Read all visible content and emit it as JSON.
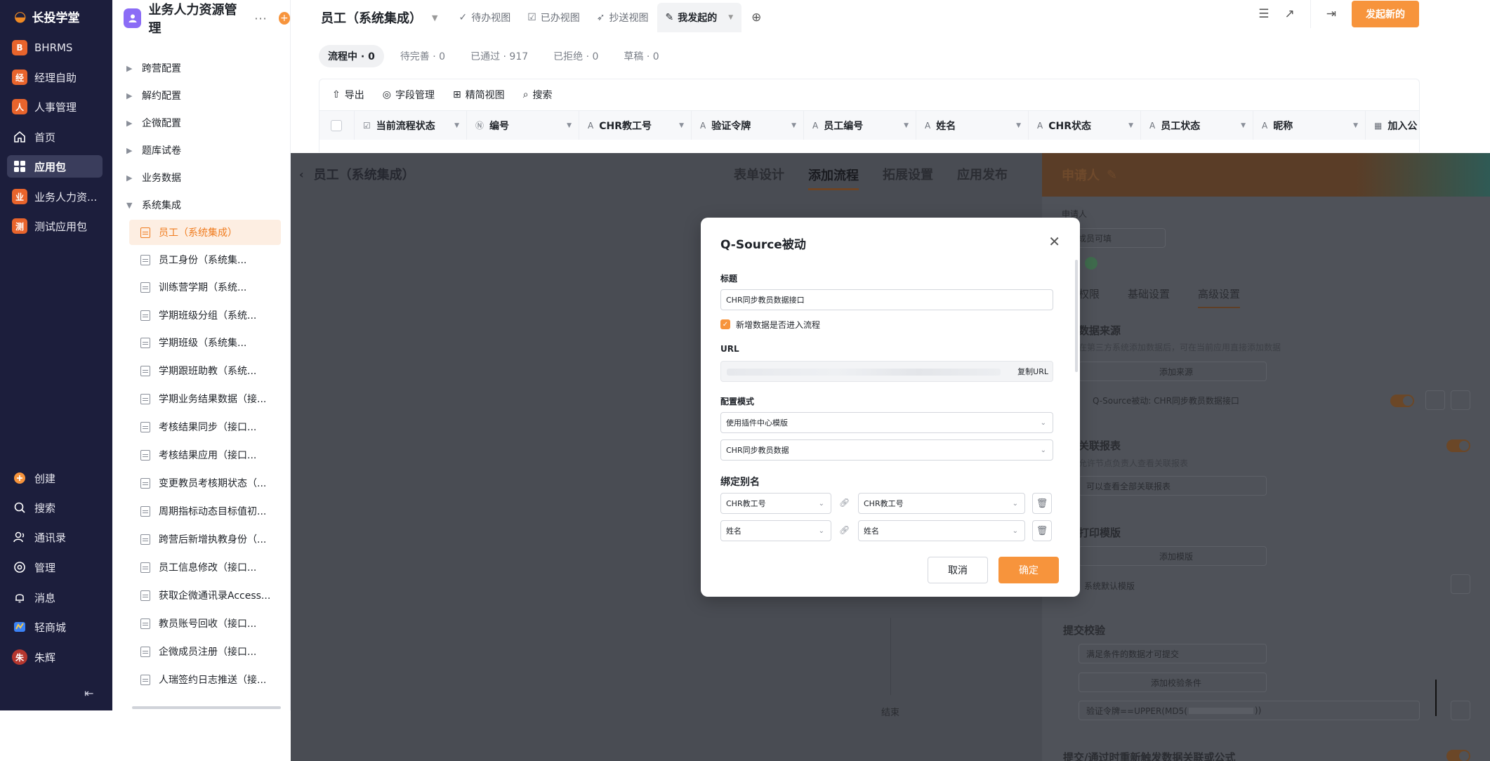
{
  "brand": {
    "name": "长投学堂"
  },
  "nav": {
    "items": [
      {
        "label": "BHRMS",
        "badge": "B",
        "color": "#e8642c"
      },
      {
        "label": "经理自助",
        "badge": "经",
        "color": "#e8642c"
      },
      {
        "label": "人事管理",
        "badge": "人",
        "color": "#e8642c"
      },
      {
        "label": "首页",
        "icon": "home-icon"
      },
      {
        "label": "应用包",
        "icon": "grid-icon",
        "active": true
      },
      {
        "label": "业务人力资...",
        "badge": "业",
        "color": "#e8642c"
      },
      {
        "label": "测试应用包",
        "badge": "测",
        "color": "#e8642c"
      }
    ],
    "bottom": [
      {
        "label": "创建",
        "icon": "plus-circle-icon"
      },
      {
        "label": "搜索",
        "icon": "search-icon"
      },
      {
        "label": "通讯录",
        "icon": "contacts-icon"
      },
      {
        "label": "管理",
        "icon": "settings-icon"
      },
      {
        "label": "消息",
        "icon": "bell-icon"
      },
      {
        "label": "轻商城",
        "icon": "store-icon"
      },
      {
        "label": "朱辉",
        "icon": "avatar",
        "avatar_text": "朱"
      }
    ]
  },
  "tree": {
    "app_title": "业务人力资源管理",
    "groups": [
      "跨营配置",
      "解约配置",
      "企微配置",
      "题库试卷",
      "业务数据",
      "系统集成"
    ],
    "leaves": [
      "员工（系统集成）",
      "员工身份（系统集...",
      "训练营学期（系统...",
      "学期班级分组（系统...",
      "学期班级（系统集...",
      "学期跟班助教（系统...",
      "学期业务结果数据（接...",
      "考核结果同步（接口...",
      "考核结果应用（接口...",
      "变更教员考核期状态（...",
      "周期指标动态目标值初...",
      "跨营后新增执教身份（...",
      "员工信息修改（接口...",
      "获取企微通讯录Access...",
      "教员账号回收（接口...",
      "企微成员注册（接口...",
      "人瑞签约日志推送（接..."
    ]
  },
  "topbar": {
    "page_title": "员工（系统集成）",
    "tabs": [
      "待办视图",
      "已办视图",
      "抄送视图",
      "我发起的"
    ],
    "start_button": "发起新的"
  },
  "filters": [
    "流程中 · 0",
    "待完善 · 0",
    "已通过 · 917",
    "已拒绝 · 0",
    "草稿 · 0"
  ],
  "toolbar": [
    "导出",
    "字段管理",
    "精简视图",
    "搜索"
  ],
  "columns": [
    "当前流程状态",
    "编号",
    "CHR教工号",
    "验证令牌",
    "员工编号",
    "姓名",
    "CHR状态",
    "员工状态",
    "昵称",
    "加入公"
  ],
  "background": {
    "flow_title": "员工（系统集成）",
    "flow_tabs": [
      "表单设计",
      "添加流程",
      "拓展设置",
      "应用发布"
    ],
    "end_label": "结束",
    "panel": {
      "title": "申请人",
      "applicant_label": "申请人",
      "applicant_value": "全成员可填",
      "tabs": [
        "权限",
        "基础设置",
        "高级设置"
      ],
      "data_source_title": "数据来源",
      "data_source_desc": "在第三方系统添加数据后，可在当前应用直接添加数据",
      "add_source": "添加来源",
      "source_item": "Q-Source被动: CHR同步教员数据接口",
      "related_report_title": "关联报表",
      "related_report_desc": "允许节点负责人查看关联报表",
      "related_report_value": "可以查看全部关联报表",
      "print_title": "打印模版",
      "add_template": "添加模版",
      "default_template": "系统默认模版",
      "submit_check_title": "提交校验",
      "submit_check_value": "满足条件的数据才可提交",
      "add_check": "添加校验条件",
      "check_formula": "验证令牌==UPPER(MD5(",
      "check_formula_end": "))",
      "retrigger_title": "提交/通过时重新触发数据关联或公式"
    }
  },
  "modal": {
    "title": "Q-Source被动",
    "title_label": "标题",
    "title_value": "CHR同步教员数据接口",
    "checkbox_label": "新增数据是否进入流程",
    "url_label": "URL",
    "copy_url": "复制URL",
    "mode_label": "配置模式",
    "mode_value": "使用插件中心模版",
    "template_value": "CHR同步教员数据",
    "alias_label": "绑定别名",
    "alias_rows": [
      {
        "left": "CHR教工号",
        "right": "CHR教工号"
      },
      {
        "left": "姓名",
        "right": "姓名"
      }
    ],
    "cancel": "取消",
    "confirm": "确定"
  }
}
